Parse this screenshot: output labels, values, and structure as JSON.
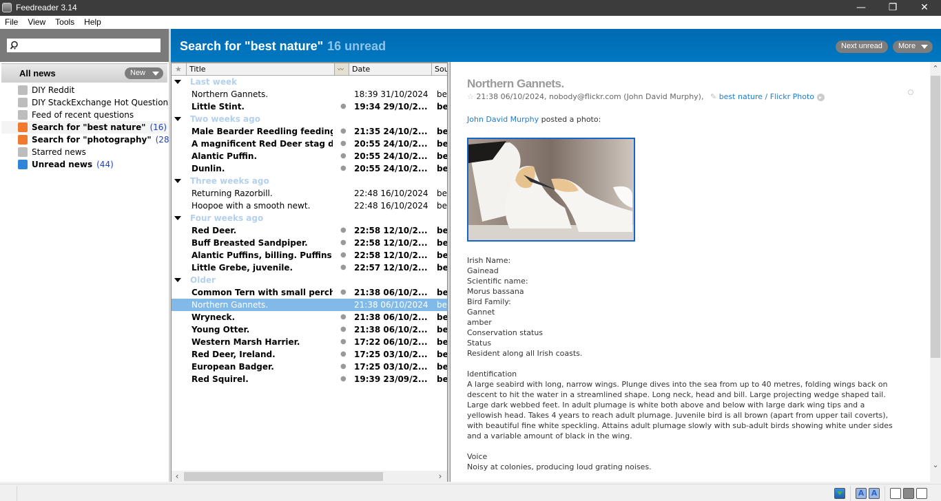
{
  "window": {
    "title": "Feedreader 3.14",
    "controls": {
      "minimize": "—",
      "restore": "❐",
      "close": "✕"
    }
  },
  "menu": [
    "File",
    "View",
    "Tools",
    "Help"
  ],
  "sidebar": {
    "search_placeholder": "",
    "all_news_label": "All news",
    "new_button": "New",
    "feeds": [
      {
        "name": "DIY Reddit",
        "count": "",
        "bold": false,
        "icon": "rss-gray-icon"
      },
      {
        "name": "DIY StackExchange Hot Questions",
        "count": "",
        "bold": false,
        "icon": "rss-gray-icon"
      },
      {
        "name": "Feed of recent questions",
        "count": "",
        "bold": false,
        "icon": "rss-gray-icon"
      },
      {
        "name": "Search for \"best nature\"",
        "count": "(16)",
        "bold": true,
        "icon": "search-feed-icon",
        "selected": true
      },
      {
        "name": "Search for \"photography\"",
        "count": "(28)",
        "bold": true,
        "icon": "search-feed-icon"
      },
      {
        "name": "Starred news",
        "count": "",
        "bold": false,
        "icon": "rss-gray-icon"
      },
      {
        "name": "Unread news",
        "count": "(44)",
        "bold": true,
        "icon": "unread-feed-icon"
      }
    ]
  },
  "header": {
    "title": "Search for \"best nature\"",
    "unread": "16 unread",
    "next_unread": "Next unread",
    "more": "More"
  },
  "list": {
    "columns": {
      "title": "Title",
      "date": "Date",
      "source": "Sou"
    },
    "groups": [
      {
        "name": "Last week",
        "items": [
          {
            "title": "Northern Gannets.",
            "date": "18:39 31/10/2024",
            "source": "be",
            "unread": false
          },
          {
            "title": "Little Stint.",
            "date": "19:34 29/10/2...",
            "source": "be",
            "unread": true
          }
        ]
      },
      {
        "name": "Two weeks ago",
        "items": [
          {
            "title": "Male Bearder Reedling feeding ...",
            "date": "21:35 24/10/2...",
            "source": "be",
            "unread": true
          },
          {
            "title": "A magnificent Red Deer stag d...",
            "date": "20:55 24/10/2...",
            "source": "be",
            "unread": true
          },
          {
            "title": "Alantic Puffin.",
            "date": "20:55 24/10/2...",
            "source": "be",
            "unread": true
          },
          {
            "title": "Dunlin.",
            "date": "20:55 24/10/2...",
            "source": "be",
            "unread": true
          }
        ]
      },
      {
        "name": "Three weeks ago",
        "items": [
          {
            "title": "Returning Razorbill.",
            "date": "22:48 16/10/2024",
            "source": "be",
            "unread": false
          },
          {
            "title": "Hoopoe with a smooth newt.",
            "date": "22:48 16/10/2024",
            "source": "be",
            "unread": false
          }
        ]
      },
      {
        "name": "Four weeks ago",
        "items": [
          {
            "title": "Red Deer.",
            "date": "22:58 12/10/2...",
            "source": "be",
            "unread": true
          },
          {
            "title": "Buff Breasted Sandpiper.",
            "date": "22:58 12/10/2...",
            "source": "be",
            "unread": true
          },
          {
            "title": "Alantic Puffins, billing. Puffins ...",
            "date": "22:58 12/10/2...",
            "source": "be",
            "unread": true
          },
          {
            "title": "Little Grebe, juvenile.",
            "date": "22:57 12/10/2...",
            "source": "be",
            "unread": true
          }
        ]
      },
      {
        "name": "Older",
        "items": [
          {
            "title": "Common Tern with small perch.",
            "date": "21:38 06/10/2...",
            "source": "be",
            "unread": true
          },
          {
            "title": "Northern Gannets.",
            "date": "21:38 06/10/2024",
            "source": "be",
            "unread": false,
            "selected": true
          },
          {
            "title": "Wryneck.",
            "date": "21:38 06/10/2...",
            "source": "be",
            "unread": true
          },
          {
            "title": "Young Otter.",
            "date": "21:38 06/10/2...",
            "source": "be",
            "unread": true
          },
          {
            "title": "Western Marsh Harrier.",
            "date": "17:22 06/10/2...",
            "source": "be",
            "unread": true
          },
          {
            "title": "Red Deer, Ireland.",
            "date": "17:25 03/10/2...",
            "source": "be",
            "unread": true
          },
          {
            "title": "European Badger.",
            "date": "17:25 03/10/2...",
            "source": "be",
            "unread": true
          },
          {
            "title": "Red Squirel.",
            "date": "19:39 23/09/2...",
            "source": "be",
            "unread": true
          }
        ]
      }
    ]
  },
  "article": {
    "title": "Northern Gannets.",
    "meta_date": "21:38 06/10/2024, nobody@flickr.com (John David Murphy),",
    "meta_link": "best nature / Flickr Photo",
    "author_link": "John David Murphy",
    "posted_text": " posted a photo:",
    "photo_alt": "Two northern gannets preening",
    "body": "Irish Name:\nGainead\nScientific name:\nMorus bassana\nBird Family:\nGannet\namber\nConservation status\nStatus\nResident along all Irish coasts.\n\nIdentification\nA large seabird with long, narrow wings. Plunge dives into the sea from up to 40 metres, folding wings back on\ndescent to hit the water in a streamlined shape. Long neck, head and bill. Large projecting wedge shaped tail.\nLarge dark webbed feet. In adult plumage is white both above and below with large dark wing tips and a\nyellowish head. Takes 4 years to reach adult plumage. Juvenile bird is all brown (apart from upper tail coverts),\nwith beautiful fine white speckling. Attains adult plumage slowly with sub-adult birds showing white under sides\nand a variable amount of black in the wing.\n\nVoice\nNoisy at colonies, producing loud grating noises."
  },
  "colors": {
    "accent": "#0073bb",
    "selection": "#81b9e8",
    "link": "#1f7bd2",
    "count": "#1a3fd8"
  }
}
